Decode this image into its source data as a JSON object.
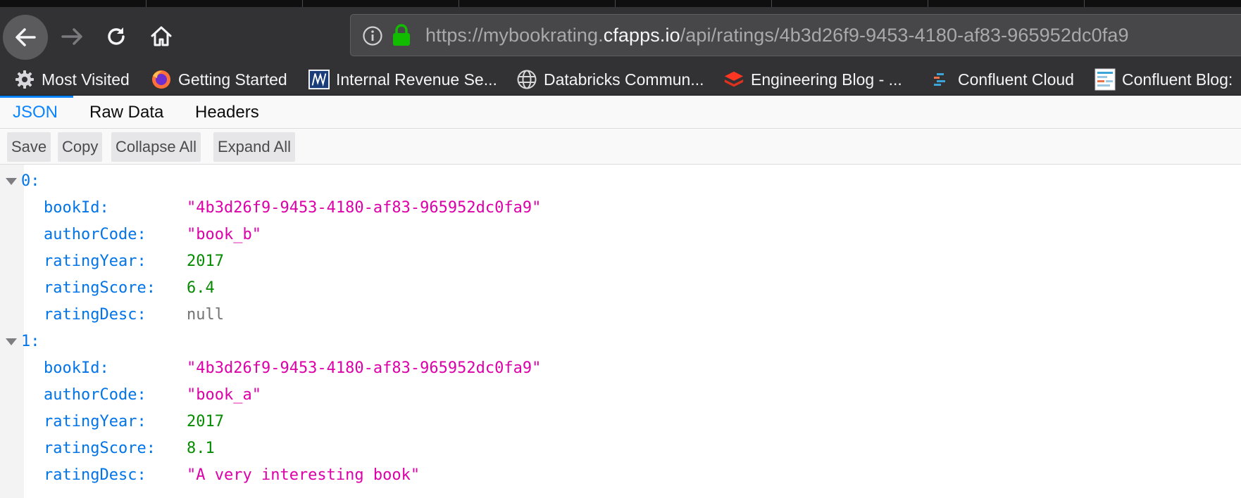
{
  "navigation": {
    "url_prefix": "https://mybookrating.",
    "url_domain": "cfapps.io",
    "url_path": "/api/ratings/4b3d26f9-9453-4180-af83-965952dc0fa9"
  },
  "bookmarks": [
    {
      "label": "Most Visited",
      "icon": "gear-icon"
    },
    {
      "label": "Getting Started",
      "icon": "firefox-icon"
    },
    {
      "label": "Internal Revenue Se...",
      "icon": "irs-icon"
    },
    {
      "label": "Databricks Commun...",
      "icon": "globe-icon"
    },
    {
      "label": "Engineering Blog - ...",
      "icon": "stack-icon"
    },
    {
      "label": "Confluent Cloud",
      "icon": "confluent-icon"
    },
    {
      "label": "Confluent Blog:",
      "icon": "document-icon"
    }
  ],
  "viewer_tabs": {
    "json": "JSON",
    "raw": "Raw Data",
    "headers": "Headers",
    "active": "JSON"
  },
  "toolbar": {
    "save": "Save",
    "copy": "Copy",
    "collapse": "Collapse All",
    "expand": "Expand All"
  },
  "records": [
    {
      "index": "0:",
      "fields": [
        {
          "key": "bookId:",
          "value": "\"4b3d26f9-9453-4180-af83-965952dc0fa9\"",
          "type": "string"
        },
        {
          "key": "authorCode:",
          "value": "\"book_b\"",
          "type": "string"
        },
        {
          "key": "ratingYear:",
          "value": "2017",
          "type": "number"
        },
        {
          "key": "ratingScore:",
          "value": "6.4",
          "type": "number"
        },
        {
          "key": "ratingDesc:",
          "value": "null",
          "type": "null"
        }
      ]
    },
    {
      "index": "1:",
      "fields": [
        {
          "key": "bookId:",
          "value": "\"4b3d26f9-9453-4180-af83-965952dc0fa9\"",
          "type": "string"
        },
        {
          "key": "authorCode:",
          "value": "\"book_a\"",
          "type": "string"
        },
        {
          "key": "ratingYear:",
          "value": "2017",
          "type": "number"
        },
        {
          "key": "ratingScore:",
          "value": "8.1",
          "type": "number"
        },
        {
          "key": "ratingDesc:",
          "value": "\"A very interesting book\"",
          "type": "string"
        }
      ]
    }
  ],
  "colors": {
    "accent": "#0a84ff",
    "json_key": "#0074e8",
    "json_string": "#dd00a9",
    "json_number": "#058b00",
    "json_null": "#737373",
    "chrome_dark": "#323234"
  }
}
